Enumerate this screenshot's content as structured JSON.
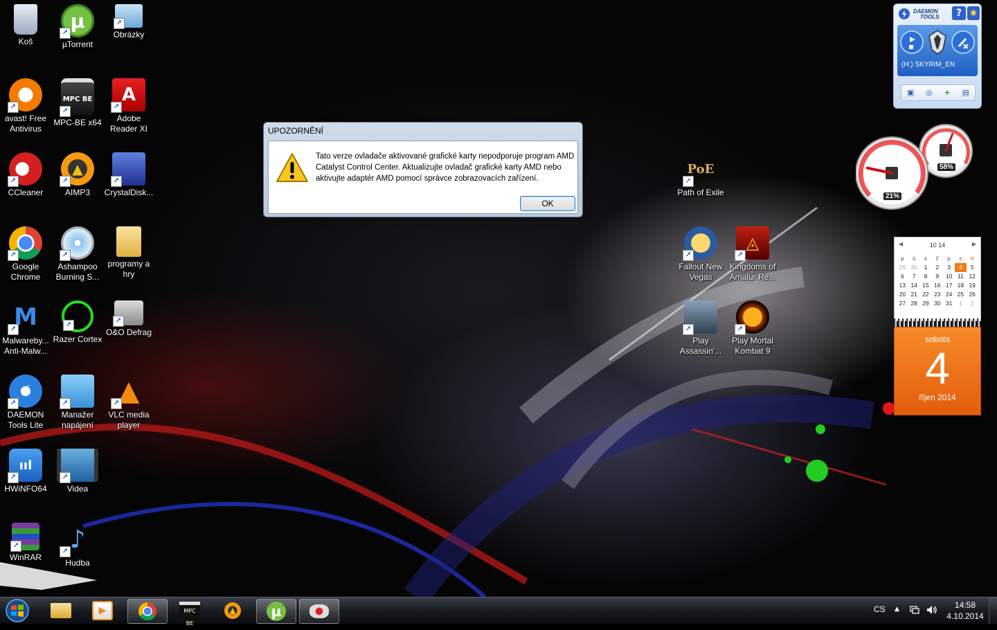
{
  "desktop": {
    "icons": [
      {
        "label": "Koš"
      },
      {
        "label": "µTorrent"
      },
      {
        "label": "Obrázky"
      },
      {
        "label": "avast! Free Antivirus"
      },
      {
        "label": "MPC-BE x64",
        "glyph_text": "MPC BE"
      },
      {
        "label": "Adobe Reader XI"
      },
      {
        "label": "CCleaner"
      },
      {
        "label": "AIMP3"
      },
      {
        "label": "CrystalDisk..."
      },
      {
        "label": "Google Chrome"
      },
      {
        "label": "Ashampoo Burning S..."
      },
      {
        "label": "programy a hry"
      },
      {
        "label": "Malwareby... Anti-Malw..."
      },
      {
        "label": "Razer Cortex"
      },
      {
        "label": "O&O Defrag"
      },
      {
        "label": "DAEMON Tools Lite"
      },
      {
        "label": "Manažer napájení"
      },
      {
        "label": "VLC media player"
      },
      {
        "label": "HWiNFO64"
      },
      {
        "label": "Videa"
      },
      {
        "label": "WinRAR"
      },
      {
        "label": "Hudba"
      },
      {
        "label": "Path of Exile",
        "glyph_text": "PoE"
      },
      {
        "label": "Fallout New Vegas"
      },
      {
        "label": "Kingdoms of Amalur Re..."
      },
      {
        "label": "Play Assassin'..."
      },
      {
        "label": "Play Mortal Kombat 9"
      }
    ]
  },
  "dialog": {
    "title": "UPOZORNĚNÍ",
    "message": "Tato verze ovladače aktivované grafické karty nepodporuje program AMD Catalyst Control Center. Aktualizujte ovladač grafické karty AMD nebo aktivujte adaptér AMD pomocí správce zobrazovacích zařízení.",
    "ok_label": "OK"
  },
  "daemon_gadget": {
    "brand_line1": "DAEMON",
    "brand_line2": "TOOLS",
    "help_label": "?",
    "drive_label": "(H:) SKYRIM_EN"
  },
  "meter_gadget": {
    "cpu_percent": 21,
    "cpu_text": "21%",
    "memory_percent": 58,
    "memory_text": "58%"
  },
  "calendar_gadget": {
    "month_header": "10 14",
    "weekday_headers": [
      "p",
      "ú",
      "s",
      "č",
      "p",
      "s",
      "n"
    ],
    "weeks": [
      [
        "29",
        "30",
        "1",
        "2",
        "3",
        "4",
        "5"
      ],
      [
        "6",
        "7",
        "8",
        "9",
        "10",
        "11",
        "12"
      ],
      [
        "13",
        "14",
        "15",
        "16",
        "17",
        "18",
        "19"
      ],
      [
        "20",
        "21",
        "22",
        "23",
        "24",
        "25",
        "26"
      ],
      [
        "27",
        "28",
        "29",
        "30",
        "31",
        "1",
        "2"
      ]
    ],
    "day_name": "sobota",
    "day_number": "4",
    "month_year": "říjen 2014"
  },
  "taskbar": {
    "language": "CS",
    "time": "14:58",
    "date": "4.10.2014",
    "buttons": [
      {
        "app": "explorer"
      },
      {
        "app": "media-player"
      },
      {
        "app": "chrome"
      },
      {
        "app": "mpc-be",
        "glyph_text": "MPC BE"
      },
      {
        "app": "aimp3"
      },
      {
        "app": "utorrent"
      },
      {
        "app": "razer-cortex"
      }
    ]
  },
  "colors": {
    "dialog_frame": "#b9c9db",
    "ok_border": "#3c7fb1",
    "calendar_orange": "#f47a1c",
    "daemon_blue": "#2f62c8"
  }
}
